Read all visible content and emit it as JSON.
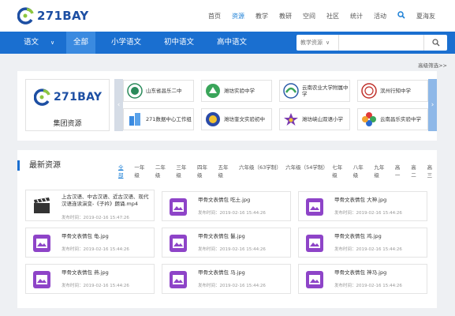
{
  "brand": {
    "logo_text": "271BAY"
  },
  "topnav": {
    "items": [
      "首页",
      "资源",
      "教学",
      "教研",
      "空间",
      "社区",
      "统计",
      "活动"
    ],
    "active": "资源",
    "user": "夏海友"
  },
  "subnav": {
    "subject": "语文",
    "items": [
      "全部",
      "小学语文",
      "初中语文",
      "高中语文"
    ],
    "active": "全部",
    "search_select": "教学资源",
    "search_placeholder": ""
  },
  "advanced_filter": "高级筛选>>",
  "group": {
    "logo_text": "271BAY",
    "name": "集团资源"
  },
  "schools": [
    "山东省昌乐二中",
    "潍坊实验中学",
    "云南农业大学附属中学",
    "滨州行知中学",
    "271数据中心工作组",
    "潍坊奎文实验初中",
    "潍坊峡山双语小学",
    "云南昌乐实验中学"
  ],
  "latest": {
    "title": "最新资源",
    "grades": [
      "全部",
      "一年级",
      "二年级",
      "三年级",
      "四年级",
      "五年级",
      "六年级（63学制）",
      "六年级（54学制）",
      "七年级",
      "八年级",
      "九年级",
      "高一",
      "高二",
      "高三"
    ],
    "active_grade": "全部",
    "cards": [
      {
        "title": "上古汉语、中古汉语、近古汉语、现代汉语连读演变-《子衿》朗诵.mp4",
        "date": "发布时间：2019-02-16 15:47:26",
        "type": "video"
      },
      {
        "title": "甲骨文表情包 吃土.jpg",
        "date": "发布时间：2019-02-16 15:44:26",
        "type": "image"
      },
      {
        "title": "甲骨文表情包 大神.jpg",
        "date": "发布时间：2019-02-16 15:44:26",
        "type": "image"
      },
      {
        "title": "甲骨文表情包 龟.jpg",
        "date": "发布时间：2019-02-16 15:44:26",
        "type": "image"
      },
      {
        "title": "甲骨文表情包 鬣.jpg",
        "date": "发布时间：2019-02-16 15:44:26",
        "type": "image"
      },
      {
        "title": "甲骨文表情包 鸡.jpg",
        "date": "发布时间：2019-02-16 15:44:26",
        "type": "image"
      },
      {
        "title": "甲骨文表情包 燕.jpg",
        "date": "发布时间：2019-02-16 15:44:26",
        "type": "image"
      },
      {
        "title": "甲骨文表情包 马.jpg",
        "date": "发布时间：2019-02-16 15:44:26",
        "type": "image"
      },
      {
        "title": "甲骨文表情包 神马.jpg",
        "date": "发布时间：2019-02-16 15:44:26",
        "type": "image"
      }
    ]
  }
}
